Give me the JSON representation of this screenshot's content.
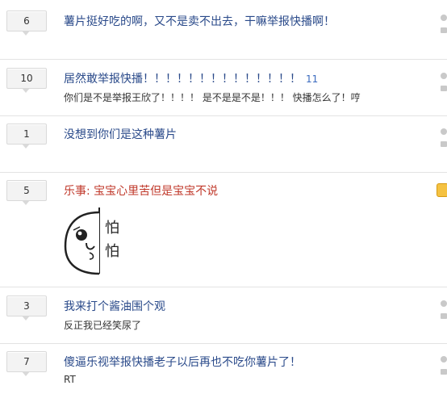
{
  "comments": [
    {
      "count": "6",
      "title": "薯片挺好吃的啊，又不是卖不出去，干嘛举报快播啊！",
      "sub": "",
      "title_color": "link"
    },
    {
      "count": "10",
      "title": "居然敢举报快播！！！！！！！！！！！！！！",
      "extra": "11",
      "sub": "你们是不是举报王欣了！！！！ 是不是是不是！！！ 快播怎么了！哼",
      "title_color": "link"
    },
    {
      "count": "1",
      "title": "没想到你们是这种薯片",
      "sub": "",
      "title_color": "link"
    },
    {
      "count": "5",
      "title": "乐事: 宝宝心里苦但是宝宝不说",
      "sub": "",
      "title_color": "red",
      "sticker_text": [
        "怕",
        "怕"
      ]
    },
    {
      "count": "3",
      "title": "我来打个酱油围个观",
      "sub": "反正我已经笑尿了",
      "title_color": "link"
    },
    {
      "count": "7",
      "title": "傻逼乐视举报快播老子以后再也不吃你薯片了！",
      "sub": "RT",
      "title_color": "link"
    }
  ],
  "icons": {
    "side_top": "user-icon",
    "side_bottom": "comment-icon",
    "badge": "emoji-badge-icon"
  },
  "colors": {
    "link": "#2a4a8a",
    "red": "#c0392b",
    "count_bg": "#f3f3f3"
  }
}
